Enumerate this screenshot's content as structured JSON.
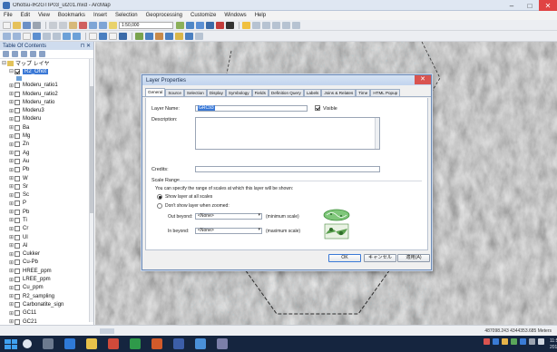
{
  "window": {
    "title": "Ohotsu-lR2GTIP03_ul201.mxd - ArcMap"
  },
  "menu": [
    "File",
    "Edit",
    "View",
    "Bookmarks",
    "Insert",
    "Selection",
    "Geoprocessing",
    "Customize",
    "Windows",
    "Help"
  ],
  "toolbar": {
    "scale_value": "1:50,000"
  },
  "toc": {
    "title": "Table Of Contents",
    "group": "マップ レイヤ",
    "selected_layer": "R2_Ohot",
    "layers": [
      "Moderu_ratio1",
      "Moderu_ratio2",
      "Moderu_ratio",
      "Moderu3",
      "Moderu",
      "Ba",
      "Mg",
      "Zn",
      "Ag",
      "Au",
      "Pb",
      "W",
      "Sr",
      "Sc",
      "P",
      "Pb",
      "Ti",
      "Cr",
      "Ul",
      "Al",
      "Cukker",
      "Cu-Pb",
      "HREE_ppm",
      "LREE_ppm",
      "Cu_ppm",
      "R2_sampling",
      "Carbonatite_sign",
      "GC11",
      "GC21"
    ]
  },
  "dialog": {
    "title": "Layer Properties",
    "tabs": [
      "General",
      "Source",
      "Selection",
      "Display",
      "Symbology",
      "Fields",
      "Definition Query",
      "Labels",
      "Joins & Relates",
      "Time",
      "HTML Popup"
    ],
    "active_tab": "General",
    "layer_name_label": "Layer Name:",
    "layer_name_value": "GRC93",
    "visible_label": "Visible",
    "description_label": "Description:",
    "credits_label": "Credits:",
    "scale_range_title": "Scale Range",
    "scale_range_desc": "You can specify the range of scales at which this layer will be shown:",
    "radio_show_all": "Show layer at all scales",
    "radio_dont_show": "Don't show layer when zoomed:",
    "out_beyond_label": "Out beyond:",
    "out_beyond_value": "<None>",
    "minimum_scale": "(minimum scale)",
    "in_beyond_label": "In beyond:",
    "in_beyond_value": "<None>",
    "maximum_scale": "(maximum scale)",
    "ok": "OK",
    "cancel": "キャンセル",
    "apply": "適用(A)"
  },
  "status": {
    "coords": "487098.243 4344353.685 Meters"
  },
  "taskbar": {
    "clock_time": "11:54",
    "clock_date": "2019/10/21"
  }
}
